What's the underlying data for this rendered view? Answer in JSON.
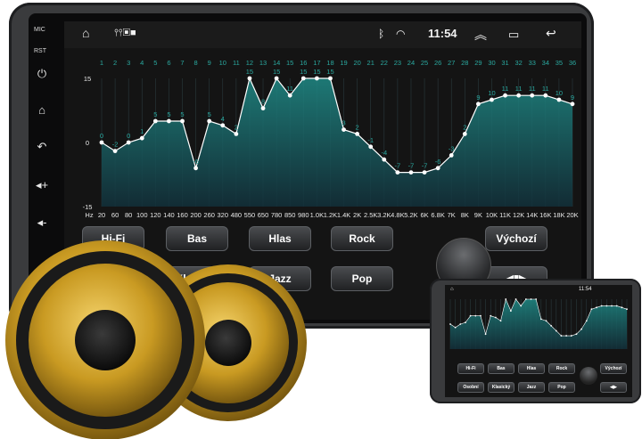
{
  "side": {
    "mic_label": "MIC",
    "rst_label": "RST"
  },
  "status": {
    "time": "11:54"
  },
  "eq": {
    "band_numbers": [
      "1",
      "2",
      "3",
      "4",
      "5",
      "6",
      "7",
      "8",
      "9",
      "10",
      "11",
      "12",
      "13",
      "14",
      "15",
      "16",
      "17",
      "18",
      "19",
      "20",
      "21",
      "22",
      "23",
      "24",
      "25",
      "26",
      "27",
      "28",
      "29",
      "30",
      "31",
      "32",
      "33",
      "34",
      "35",
      "36"
    ],
    "hz_label": "Hz",
    "freq_labels": [
      "20",
      "60",
      "80",
      "100",
      "120",
      "140",
      "160",
      "200",
      "260",
      "320",
      "480",
      "550",
      "650",
      "780",
      "850",
      "980",
      "1.0K",
      "1.2K",
      "1.4K",
      "2K",
      "2.5K",
      "3.2K",
      "4.8K",
      "5.2K",
      "6K",
      "6.8K",
      "7K",
      "8K",
      "9K",
      "10K",
      "11K",
      "12K",
      "14K",
      "16K",
      "18K",
      "20K"
    ],
    "levels": [
      0,
      -2,
      0,
      1,
      5,
      5,
      5,
      -6,
      5,
      4,
      2,
      15,
      8,
      15,
      11,
      15,
      15,
      15,
      3,
      2,
      -1,
      -4,
      -7,
      -7,
      -7,
      -6,
      -3,
      2,
      9,
      10,
      11,
      11,
      11,
      11,
      10,
      9
    ],
    "y_labels": {
      "top": "15",
      "mid": "0",
      "bottom": "-15"
    }
  },
  "presets": {
    "row1": [
      "Hi-Fi",
      "Bas",
      "Hlas",
      "Rock",
      "Výchozí"
    ],
    "row2": [
      "Klasický",
      "Jazz",
      "Pop"
    ]
  },
  "tablet": {
    "time": "11:54",
    "row1": [
      "Hi-Fi",
      "Bas",
      "Hlas",
      "Rock",
      "Výchozí"
    ],
    "row2": [
      "Osobní",
      "Klasický",
      "Jazz",
      "Pop"
    ]
  },
  "colors": {
    "accent": "#2aa9a0",
    "curve": "#ffffff",
    "fill_top": "#1f8a86",
    "fill_bottom": "#12303a",
    "speaker_gold": "#c8a02a"
  }
}
